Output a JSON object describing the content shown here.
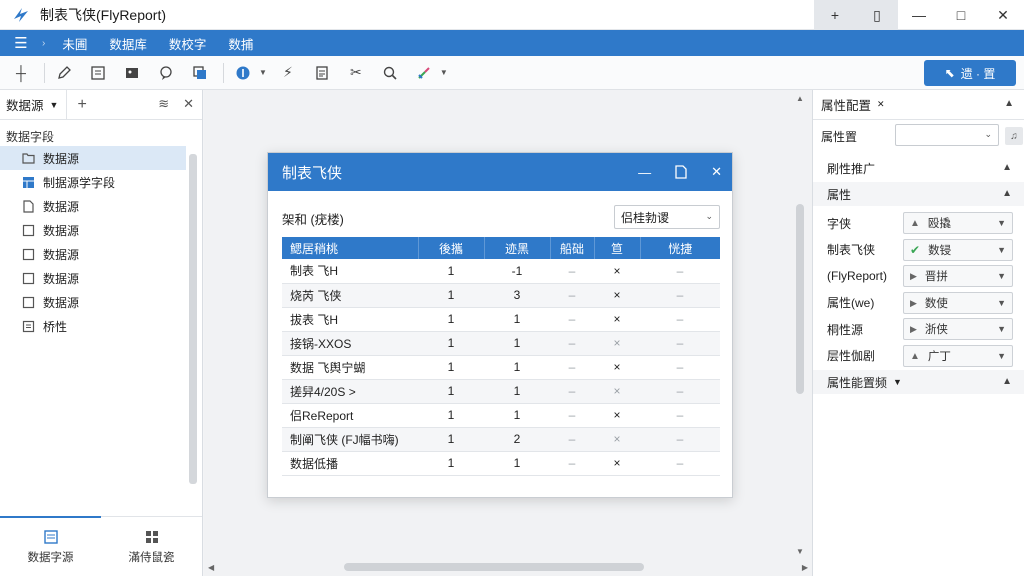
{
  "window": {
    "title": "制表飞侠(FlyReport)",
    "controls": [
      "+",
      "▯",
      "—",
      "□",
      "✕"
    ]
  },
  "menu": {
    "items": [
      "未圃",
      "数据库",
      "数校字",
      "数捕"
    ]
  },
  "toolbar": {
    "primary_label": "遗 · 置"
  },
  "left_panel": {
    "tab_label": "数据源",
    "section_label": "数据字段",
    "items": [
      {
        "label": "数据源",
        "icon": "folder-icon",
        "selected": true
      },
      {
        "label": "制据源学字段",
        "icon": "table-icon",
        "selected": false
      },
      {
        "label": "数据源",
        "icon": "file-icon",
        "selected": false
      },
      {
        "label": "数据源",
        "icon": "checkbox-icon",
        "selected": false
      },
      {
        "label": "数据源",
        "icon": "checkbox-icon",
        "selected": false
      },
      {
        "label": "数据源",
        "icon": "checkbox-icon",
        "selected": false
      },
      {
        "label": "数据源",
        "icon": "checkbox-icon",
        "selected": false
      },
      {
        "label": "桥性",
        "icon": "list-icon",
        "selected": false
      }
    ],
    "bottom_tabs": [
      {
        "label": "数据字源",
        "icon": "data-source-icon",
        "active": true
      },
      {
        "label": "滿侍鼠瓷",
        "icon": "grid-icon",
        "active": false
      }
    ]
  },
  "dialog": {
    "title": "制表飞侠",
    "field_label": "架和 (疣楼)",
    "select_value": "侣桂勃谡",
    "columns": [
      "鳃居稍桃",
      "後攜",
      "迹黑",
      "船础",
      "笪",
      "恍捷"
    ],
    "rows": [
      {
        "name": "制表 飞H",
        "c1": "1",
        "c2": "-1",
        "c3": "–",
        "c4": "×",
        "c5": "–",
        "dim": false
      },
      {
        "name": "烧芮 飞侠",
        "c1": "1",
        "c2": "3",
        "c3": "–",
        "c4": "×",
        "c5": "–",
        "dim": false
      },
      {
        "name": "拔表 飞H",
        "c1": "1",
        "c2": "1",
        "c3": "–",
        "c4": "×",
        "c5": "–",
        "dim": false
      },
      {
        "name": "接锅-XXOS",
        "c1": "1",
        "c2": "1",
        "c3": "–",
        "c4": "×",
        "c5": "–",
        "dim": true
      },
      {
        "name": "数据 飞舆宁蝴",
        "c1": "1",
        "c2": "1",
        "c3": "–",
        "c4": "×",
        "c5": "–",
        "dim": false
      },
      {
        "name": "搓舁4/20S >",
        "c1": "1",
        "c2": "1",
        "c3": "–",
        "c4": "×",
        "c5": "–",
        "dim": true
      },
      {
        "name": "侣ReReport",
        "c1": "1",
        "c2": "1",
        "c3": "–",
        "c4": "×",
        "c5": "–",
        "dim": false
      },
      {
        "name": "制阐飞侠 (FJ幅书嗨)",
        "c1": "1",
        "c2": "2",
        "c3": "–",
        "c4": "×",
        "c5": "–",
        "dim": true
      },
      {
        "name": "数据低播",
        "c1": "1",
        "c2": "1",
        "c3": "–",
        "c4": "×",
        "c5": "–",
        "dim": false
      }
    ]
  },
  "right_panel": {
    "tab_label": "属性配置",
    "field_label": "属性置",
    "section1": "刷性推广",
    "section2": "属性",
    "props": [
      {
        "name": "字侠",
        "value": "殴撬",
        "icon": "arrow-up-icon"
      },
      {
        "name": "制表飞侠",
        "value": "数锓",
        "icon": "check-icon"
      },
      {
        "name": "(FlyReport)",
        "value": "晋拼",
        "icon": "play-icon"
      },
      {
        "name": "属性(we)",
        "value": "数使",
        "icon": "play-icon"
      },
      {
        "name": "桐性源",
        "value": "浙侠",
        "icon": "play-icon"
      },
      {
        "name": "层性伽剧",
        "value": "广丁",
        "icon": "arrow-up-icon"
      }
    ],
    "section3": "属性能置频"
  },
  "colors": {
    "accent": "#2f79c9",
    "selection": "#dbe8f6",
    "check": "#3aa655"
  }
}
